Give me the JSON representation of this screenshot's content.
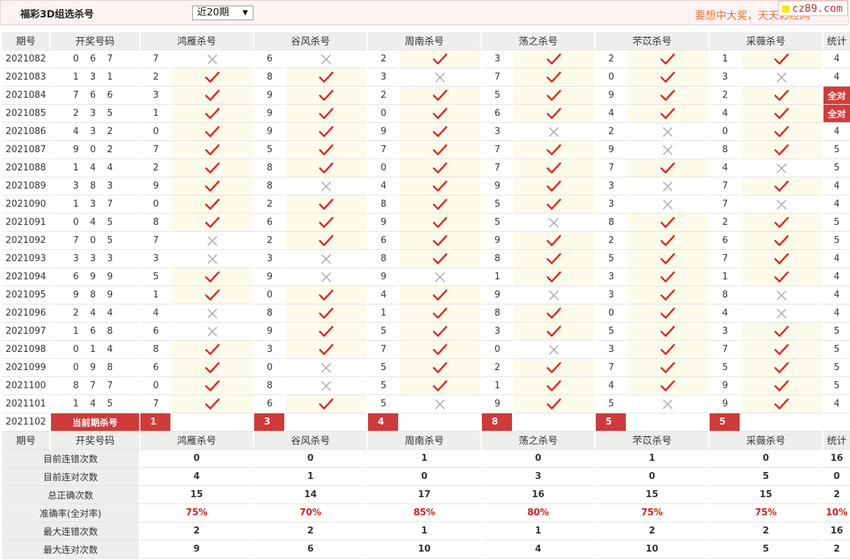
{
  "header": {
    "title": "福彩3D组选杀号",
    "select_value": "近20期",
    "slogan": "要想中大奖，天天彩经网",
    "logo_text": "cz89.com"
  },
  "table": {
    "headers": [
      "期号",
      "开奖号码",
      "鸿雁杀号",
      "谷风杀号",
      "周南杀号",
      "荡之杀号",
      "芣苡杀号",
      "采薇杀号",
      "统计"
    ],
    "rows": [
      {
        "issue": "2021082",
        "draw": "0 6 7",
        "picks": [
          [
            "7",
            false
          ],
          [
            "6",
            false
          ],
          [
            "2",
            true
          ],
          [
            "3",
            true
          ],
          [
            "2",
            true
          ],
          [
            "1",
            true
          ]
        ],
        "stat": "4"
      },
      {
        "issue": "2021083",
        "draw": "1 3 1",
        "picks": [
          [
            "2",
            true
          ],
          [
            "8",
            true
          ],
          [
            "3",
            false
          ],
          [
            "7",
            true
          ],
          [
            "0",
            true
          ],
          [
            "3",
            false
          ]
        ],
        "stat": "4"
      },
      {
        "issue": "2021084",
        "draw": "7 6 6",
        "picks": [
          [
            "3",
            true
          ],
          [
            "9",
            true
          ],
          [
            "2",
            true
          ],
          [
            "5",
            true
          ],
          [
            "9",
            true
          ],
          [
            "2",
            true
          ]
        ],
        "stat": "全对"
      },
      {
        "issue": "2021085",
        "draw": "2 3 5",
        "picks": [
          [
            "1",
            true
          ],
          [
            "9",
            true
          ],
          [
            "0",
            true
          ],
          [
            "6",
            true
          ],
          [
            "4",
            true
          ],
          [
            "4",
            true
          ]
        ],
        "stat": "全对"
      },
      {
        "issue": "2021086",
        "draw": "4 3 2",
        "picks": [
          [
            "0",
            true
          ],
          [
            "9",
            true
          ],
          [
            "9",
            true
          ],
          [
            "3",
            false
          ],
          [
            "2",
            false
          ],
          [
            "0",
            true
          ]
        ],
        "stat": "4"
      },
      {
        "issue": "2021087",
        "draw": "9 0 2",
        "picks": [
          [
            "7",
            true
          ],
          [
            "5",
            true
          ],
          [
            "7",
            true
          ],
          [
            "7",
            true
          ],
          [
            "9",
            false
          ],
          [
            "8",
            true
          ]
        ],
        "stat": "5"
      },
      {
        "issue": "2021088",
        "draw": "1 4 4",
        "picks": [
          [
            "2",
            true
          ],
          [
            "8",
            true
          ],
          [
            "0",
            true
          ],
          [
            "7",
            true
          ],
          [
            "7",
            true
          ],
          [
            "4",
            false
          ]
        ],
        "stat": "5"
      },
      {
        "issue": "2021089",
        "draw": "3 8 3",
        "picks": [
          [
            "9",
            true
          ],
          [
            "8",
            false
          ],
          [
            "4",
            true
          ],
          [
            "9",
            true
          ],
          [
            "3",
            false
          ],
          [
            "7",
            true
          ]
        ],
        "stat": "4"
      },
      {
        "issue": "2021090",
        "draw": "1 3 7",
        "picks": [
          [
            "0",
            true
          ],
          [
            "2",
            true
          ],
          [
            "8",
            true
          ],
          [
            "5",
            true
          ],
          [
            "3",
            false
          ],
          [
            "7",
            false
          ]
        ],
        "stat": "4"
      },
      {
        "issue": "2021091",
        "draw": "0 4 5",
        "picks": [
          [
            "8",
            true
          ],
          [
            "6",
            true
          ],
          [
            "9",
            true
          ],
          [
            "5",
            false
          ],
          [
            "8",
            true
          ],
          [
            "2",
            true
          ]
        ],
        "stat": "5"
      },
      {
        "issue": "2021092",
        "draw": "7 0 5",
        "picks": [
          [
            "7",
            false
          ],
          [
            "2",
            true
          ],
          [
            "6",
            true
          ],
          [
            "9",
            true
          ],
          [
            "2",
            true
          ],
          [
            "6",
            true
          ]
        ],
        "stat": "5"
      },
      {
        "issue": "2021093",
        "draw": "3 3 3",
        "picks": [
          [
            "3",
            false
          ],
          [
            "3",
            false
          ],
          [
            "8",
            true
          ],
          [
            "8",
            true
          ],
          [
            "5",
            true
          ],
          [
            "7",
            true
          ]
        ],
        "stat": "4"
      },
      {
        "issue": "2021094",
        "draw": "6 9 9",
        "picks": [
          [
            "5",
            true
          ],
          [
            "9",
            false
          ],
          [
            "9",
            false
          ],
          [
            "1",
            true
          ],
          [
            "3",
            true
          ],
          [
            "1",
            true
          ]
        ],
        "stat": "4"
      },
      {
        "issue": "2021095",
        "draw": "9 8 9",
        "picks": [
          [
            "1",
            true
          ],
          [
            "0",
            true
          ],
          [
            "4",
            true
          ],
          [
            "9",
            false
          ],
          [
            "3",
            true
          ],
          [
            "8",
            false
          ]
        ],
        "stat": "4"
      },
      {
        "issue": "2021096",
        "draw": "2 4 4",
        "picks": [
          [
            "4",
            false
          ],
          [
            "8",
            true
          ],
          [
            "1",
            true
          ],
          [
            "8",
            true
          ],
          [
            "0",
            true
          ],
          [
            "4",
            false
          ]
        ],
        "stat": "4"
      },
      {
        "issue": "2021097",
        "draw": "1 6 8",
        "picks": [
          [
            "6",
            false
          ],
          [
            "9",
            true
          ],
          [
            "5",
            true
          ],
          [
            "3",
            true
          ],
          [
            "5",
            true
          ],
          [
            "3",
            true
          ]
        ],
        "stat": "5"
      },
      {
        "issue": "2021098",
        "draw": "0 1 4",
        "picks": [
          [
            "8",
            true
          ],
          [
            "3",
            true
          ],
          [
            "7",
            true
          ],
          [
            "0",
            false
          ],
          [
            "3",
            true
          ],
          [
            "7",
            true
          ]
        ],
        "stat": "5"
      },
      {
        "issue": "2021099",
        "draw": "0 9 8",
        "picks": [
          [
            "6",
            true
          ],
          [
            "0",
            false
          ],
          [
            "5",
            true
          ],
          [
            "2",
            true
          ],
          [
            "7",
            true
          ],
          [
            "5",
            true
          ]
        ],
        "stat": "5"
      },
      {
        "issue": "2021100",
        "draw": "8 7 7",
        "picks": [
          [
            "0",
            true
          ],
          [
            "8",
            false
          ],
          [
            "5",
            true
          ],
          [
            "1",
            true
          ],
          [
            "4",
            true
          ],
          [
            "9",
            true
          ]
        ],
        "stat": "5"
      },
      {
        "issue": "2021101",
        "draw": "1 4 5",
        "picks": [
          [
            "7",
            true
          ],
          [
            "6",
            true
          ],
          [
            "5",
            false
          ],
          [
            "9",
            true
          ],
          [
            "5",
            false
          ],
          [
            "9",
            true
          ]
        ],
        "stat": "4"
      }
    ],
    "current": {
      "issue": "2021102",
      "label": "当前期杀号",
      "picks": [
        "1",
        "3",
        "4",
        "8",
        "5",
        "5"
      ]
    }
  },
  "stats": {
    "headers": [
      "期号",
      "开奖号码",
      "鸿雁杀号",
      "谷风杀号",
      "周南杀号",
      "荡之杀号",
      "芣苡杀号",
      "采薇杀号",
      "统计"
    ],
    "rows": [
      {
        "label": "目前连错次数",
        "values": [
          "0",
          "0",
          "1",
          "0",
          "1",
          "0",
          "16"
        ],
        "red": false
      },
      {
        "label": "目前连对次数",
        "values": [
          "4",
          "1",
          "0",
          "3",
          "0",
          "5",
          "0"
        ],
        "red": false
      },
      {
        "label": "总正确次数",
        "values": [
          "15",
          "14",
          "17",
          "16",
          "15",
          "15",
          "2"
        ],
        "red": false
      },
      {
        "label": "准确率(全对率)",
        "values": [
          "75%",
          "70%",
          "85%",
          "80%",
          "75%",
          "75%",
          "10%"
        ],
        "red": true
      },
      {
        "label": "最大连错次数",
        "values": [
          "2",
          "2",
          "1",
          "1",
          "2",
          "2",
          "16"
        ],
        "red": false
      },
      {
        "label": "最大连对次数",
        "values": [
          "9",
          "6",
          "10",
          "4",
          "10",
          "5",
          "2"
        ],
        "red": false
      }
    ]
  },
  "colors": {
    "check": "#e02424",
    "cross": "#b0b0b0",
    "badge": "#cf3a3a",
    "stat_blue": "#1a1aa8",
    "stat_red": "#d42020"
  }
}
